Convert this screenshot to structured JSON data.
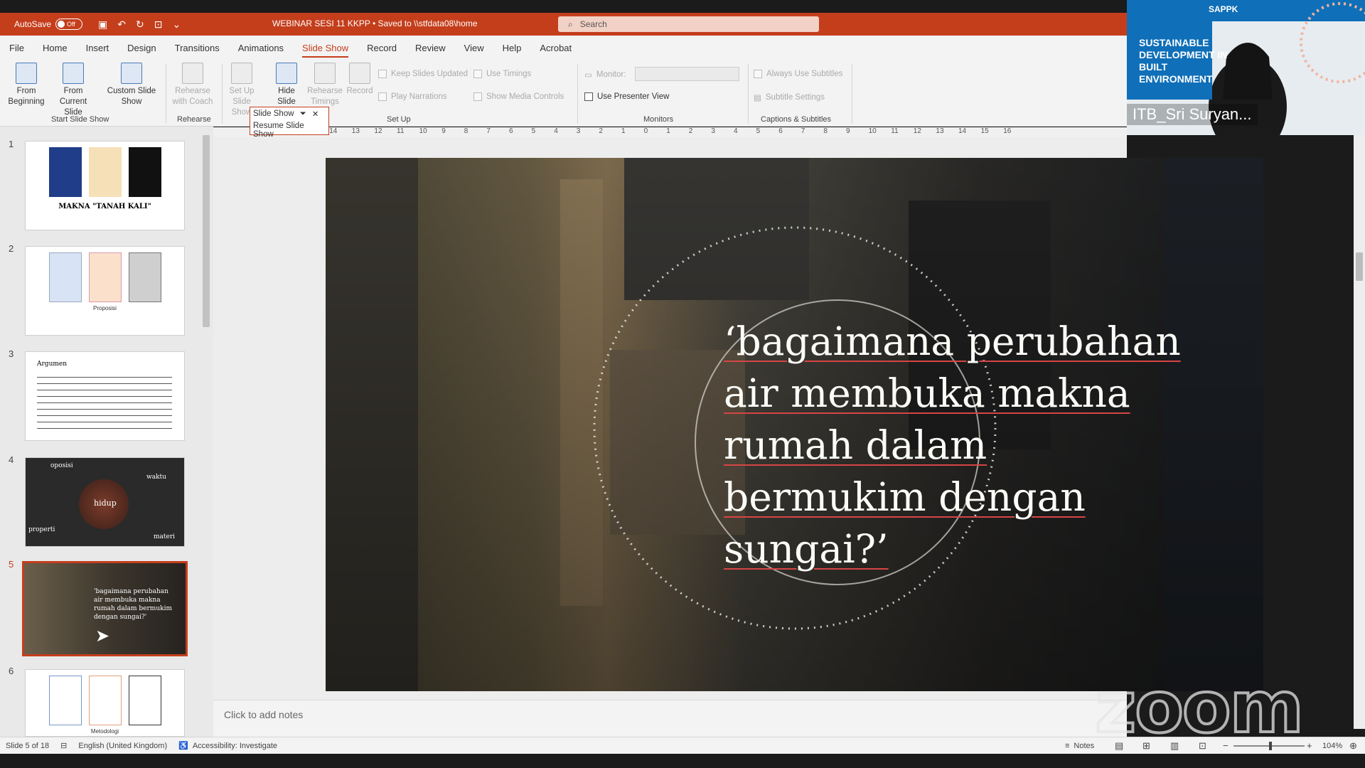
{
  "titlebar": {
    "autosave_label": "AutoSave",
    "autosave_state": "Off",
    "document_title": "WEBINAR SESI 11 KKPP • Saved to \\\\stfdata08\\home",
    "search_placeholder": "Search"
  },
  "menu": {
    "tabs": [
      "File",
      "Home",
      "Insert",
      "Design",
      "Transitions",
      "Animations",
      "Slide Show",
      "Record",
      "Review",
      "View",
      "Help",
      "Acrobat"
    ],
    "active": "Slide Show"
  },
  "ribbon": {
    "from_beginning": "From Beginning",
    "from_current": "From Current Slide",
    "custom_show": "Custom Slide Show",
    "group_start": "Start Slide Show",
    "rehearse_coach": "Rehearse with Coach",
    "group_rehearse": "Rehearse",
    "setup_show": "Set Up Slide Show",
    "hide_slide": "Hide Slide",
    "rehearse_timings": "Rehearse Timings",
    "record": "Record",
    "keep_updated": "Keep Slides Updated",
    "use_timings": "Use Timings",
    "play_narrations": "Play Narrations",
    "show_media": "Show Media Controls",
    "group_setup": "Set Up",
    "monitor_label": "Monitor:",
    "use_presenter": "Use Presenter View",
    "group_monitors": "Monitors",
    "always_subtitles": "Always Use Subtitles",
    "subtitle_settings": "Subtitle Settings",
    "group_captions": "Captions & Subtitles",
    "dropdown_item1": "Slide Show",
    "dropdown_item2": "Resume Slide Show"
  },
  "ruler": {
    "ticks": [
      "16",
      "15",
      "14",
      "13",
      "12",
      "11",
      "10",
      "9",
      "8",
      "7",
      "6",
      "5",
      "4",
      "3",
      "2",
      "1",
      "0",
      "1",
      "2",
      "3",
      "4",
      "5",
      "6",
      "7",
      "8",
      "9",
      "10",
      "11",
      "12",
      "13",
      "14",
      "15",
      "16"
    ]
  },
  "thumbnails": [
    {
      "num": "1",
      "title": "MAKNA \"TANAH KALI\""
    },
    {
      "num": "2",
      "caption": "Proposisi"
    },
    {
      "num": "3",
      "title": "Argumen"
    },
    {
      "num": "4",
      "words": [
        "oposisi",
        "waktu",
        "hidup",
        "properti",
        "materi"
      ]
    },
    {
      "num": "5",
      "text": "'bagaimana perubahan air membuka makna rumah dalam bermukim dengan sungai?'"
    },
    {
      "num": "6",
      "caption": "Metodologi"
    }
  ],
  "slide": {
    "lines": [
      "‘bagaimana perubahan",
      "air membuka makna",
      "rumah dalam",
      "bermukim dengan",
      "sungai?’"
    ]
  },
  "notes": {
    "placeholder": "Click to add notes"
  },
  "status": {
    "slide_info": "Slide 5 of 18",
    "language": "English (United Kingdom)",
    "accessibility": "Accessibility: Investigate",
    "notes_label": "Notes",
    "zoom_level": "104%"
  },
  "video": {
    "org": "SAPPK",
    "banner": "SUSTAINABLE DEVELOPMENT IN BUILT ENVIRONMENT",
    "participant": "ITB_Sri Suryan..."
  },
  "watermark": "zoom",
  "colors": {
    "accent": "#c43e1c",
    "titlebar": "#c43e1c",
    "ribbon": "#f3f3f3"
  }
}
